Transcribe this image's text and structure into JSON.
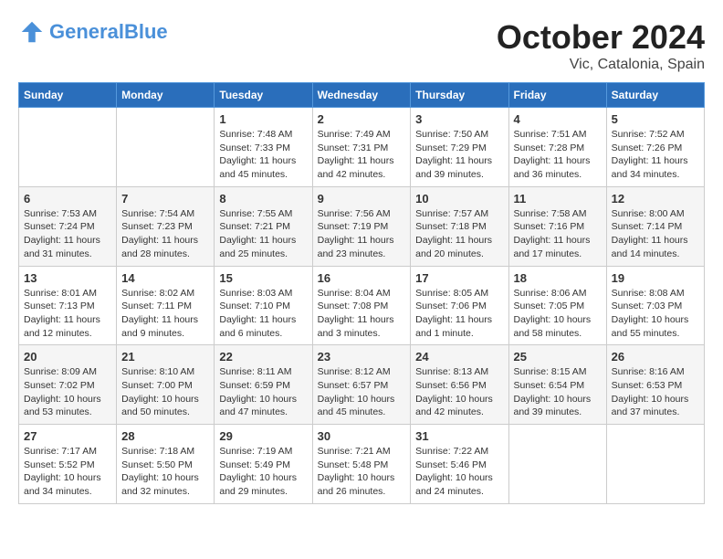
{
  "header": {
    "logo_general": "General",
    "logo_blue": "Blue",
    "month": "October 2024",
    "location": "Vic, Catalonia, Spain"
  },
  "weekdays": [
    "Sunday",
    "Monday",
    "Tuesday",
    "Wednesday",
    "Thursday",
    "Friday",
    "Saturday"
  ],
  "weeks": [
    [
      {
        "day": "",
        "detail": ""
      },
      {
        "day": "",
        "detail": ""
      },
      {
        "day": "1",
        "detail": "Sunrise: 7:48 AM\nSunset: 7:33 PM\nDaylight: 11 hours and 45 minutes."
      },
      {
        "day": "2",
        "detail": "Sunrise: 7:49 AM\nSunset: 7:31 PM\nDaylight: 11 hours and 42 minutes."
      },
      {
        "day": "3",
        "detail": "Sunrise: 7:50 AM\nSunset: 7:29 PM\nDaylight: 11 hours and 39 minutes."
      },
      {
        "day": "4",
        "detail": "Sunrise: 7:51 AM\nSunset: 7:28 PM\nDaylight: 11 hours and 36 minutes."
      },
      {
        "day": "5",
        "detail": "Sunrise: 7:52 AM\nSunset: 7:26 PM\nDaylight: 11 hours and 34 minutes."
      }
    ],
    [
      {
        "day": "6",
        "detail": "Sunrise: 7:53 AM\nSunset: 7:24 PM\nDaylight: 11 hours and 31 minutes."
      },
      {
        "day": "7",
        "detail": "Sunrise: 7:54 AM\nSunset: 7:23 PM\nDaylight: 11 hours and 28 minutes."
      },
      {
        "day": "8",
        "detail": "Sunrise: 7:55 AM\nSunset: 7:21 PM\nDaylight: 11 hours and 25 minutes."
      },
      {
        "day": "9",
        "detail": "Sunrise: 7:56 AM\nSunset: 7:19 PM\nDaylight: 11 hours and 23 minutes."
      },
      {
        "day": "10",
        "detail": "Sunrise: 7:57 AM\nSunset: 7:18 PM\nDaylight: 11 hours and 20 minutes."
      },
      {
        "day": "11",
        "detail": "Sunrise: 7:58 AM\nSunset: 7:16 PM\nDaylight: 11 hours and 17 minutes."
      },
      {
        "day": "12",
        "detail": "Sunrise: 8:00 AM\nSunset: 7:14 PM\nDaylight: 11 hours and 14 minutes."
      }
    ],
    [
      {
        "day": "13",
        "detail": "Sunrise: 8:01 AM\nSunset: 7:13 PM\nDaylight: 11 hours and 12 minutes."
      },
      {
        "day": "14",
        "detail": "Sunrise: 8:02 AM\nSunset: 7:11 PM\nDaylight: 11 hours and 9 minutes."
      },
      {
        "day": "15",
        "detail": "Sunrise: 8:03 AM\nSunset: 7:10 PM\nDaylight: 11 hours and 6 minutes."
      },
      {
        "day": "16",
        "detail": "Sunrise: 8:04 AM\nSunset: 7:08 PM\nDaylight: 11 hours and 3 minutes."
      },
      {
        "day": "17",
        "detail": "Sunrise: 8:05 AM\nSunset: 7:06 PM\nDaylight: 11 hours and 1 minute."
      },
      {
        "day": "18",
        "detail": "Sunrise: 8:06 AM\nSunset: 7:05 PM\nDaylight: 10 hours and 58 minutes."
      },
      {
        "day": "19",
        "detail": "Sunrise: 8:08 AM\nSunset: 7:03 PM\nDaylight: 10 hours and 55 minutes."
      }
    ],
    [
      {
        "day": "20",
        "detail": "Sunrise: 8:09 AM\nSunset: 7:02 PM\nDaylight: 10 hours and 53 minutes."
      },
      {
        "day": "21",
        "detail": "Sunrise: 8:10 AM\nSunset: 7:00 PM\nDaylight: 10 hours and 50 minutes."
      },
      {
        "day": "22",
        "detail": "Sunrise: 8:11 AM\nSunset: 6:59 PM\nDaylight: 10 hours and 47 minutes."
      },
      {
        "day": "23",
        "detail": "Sunrise: 8:12 AM\nSunset: 6:57 PM\nDaylight: 10 hours and 45 minutes."
      },
      {
        "day": "24",
        "detail": "Sunrise: 8:13 AM\nSunset: 6:56 PM\nDaylight: 10 hours and 42 minutes."
      },
      {
        "day": "25",
        "detail": "Sunrise: 8:15 AM\nSunset: 6:54 PM\nDaylight: 10 hours and 39 minutes."
      },
      {
        "day": "26",
        "detail": "Sunrise: 8:16 AM\nSunset: 6:53 PM\nDaylight: 10 hours and 37 minutes."
      }
    ],
    [
      {
        "day": "27",
        "detail": "Sunrise: 7:17 AM\nSunset: 5:52 PM\nDaylight: 10 hours and 34 minutes."
      },
      {
        "day": "28",
        "detail": "Sunrise: 7:18 AM\nSunset: 5:50 PM\nDaylight: 10 hours and 32 minutes."
      },
      {
        "day": "29",
        "detail": "Sunrise: 7:19 AM\nSunset: 5:49 PM\nDaylight: 10 hours and 29 minutes."
      },
      {
        "day": "30",
        "detail": "Sunrise: 7:21 AM\nSunset: 5:48 PM\nDaylight: 10 hours and 26 minutes."
      },
      {
        "day": "31",
        "detail": "Sunrise: 7:22 AM\nSunset: 5:46 PM\nDaylight: 10 hours and 24 minutes."
      },
      {
        "day": "",
        "detail": ""
      },
      {
        "day": "",
        "detail": ""
      }
    ]
  ]
}
